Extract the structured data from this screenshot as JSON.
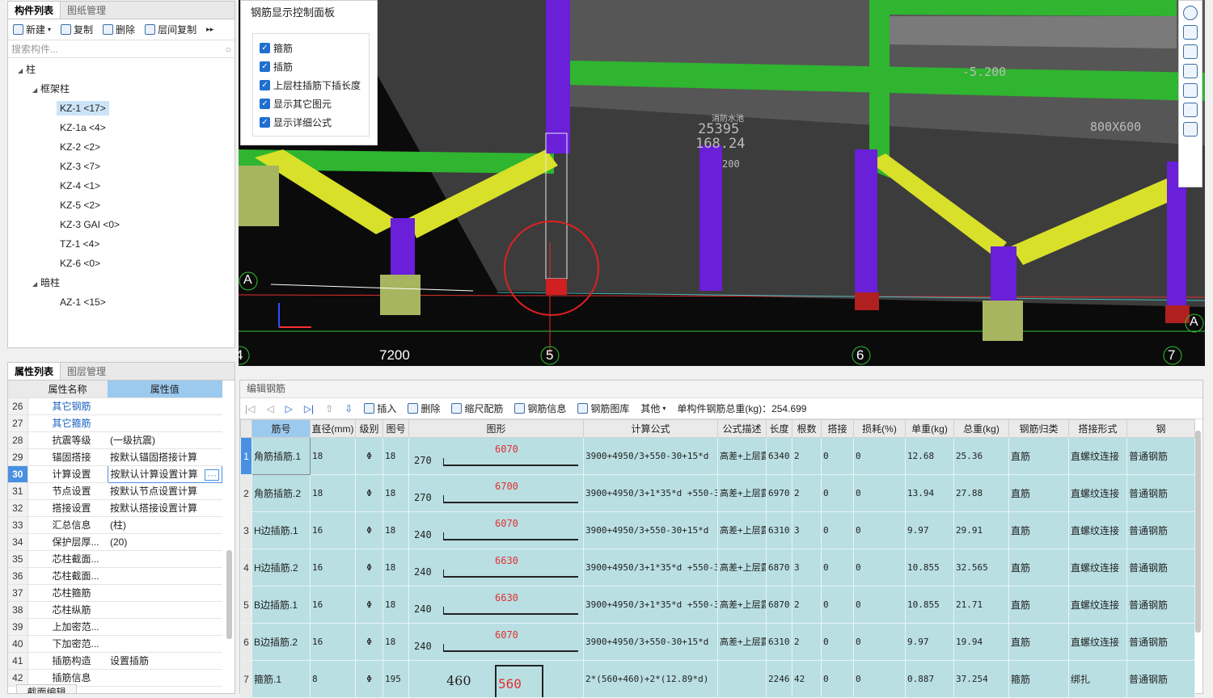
{
  "left_panel": {
    "tabs": [
      "构件列表",
      "图纸管理"
    ],
    "toolbar": {
      "new": "新建",
      "copy": "复制",
      "delete": "删除",
      "floor_copy": "层间复制"
    },
    "search_placeholder": "搜索构件...",
    "tree": {
      "root": "柱",
      "group1": "框架柱",
      "items1": [
        "KZ-1 <17>",
        "KZ-1a <4>",
        "KZ-2 <2>",
        "KZ-3 <7>",
        "KZ-4 <1>",
        "KZ-5 <2>",
        "KZ-3  GAI <0>",
        "TZ-1 <4>",
        "KZ-6 <0>"
      ],
      "group2": "暗柱",
      "items2": [
        "AZ-1 <15>"
      ]
    }
  },
  "prop_panel": {
    "tabs": [
      "属性列表",
      "图层管理"
    ],
    "header": {
      "name": "属性名称",
      "value": "属性值"
    },
    "rows": [
      {
        "no": "26",
        "name": "其它钢筋",
        "value": ""
      },
      {
        "no": "27",
        "name": "其它箍筋",
        "value": ""
      },
      {
        "no": "28",
        "name": "抗震等级",
        "value": "(一级抗震)"
      },
      {
        "no": "29",
        "name": "锚固搭接",
        "value": "按默认锚固搭接计算"
      },
      {
        "no": "30",
        "name": "计算设置",
        "value": "按默认计算设置计算"
      },
      {
        "no": "31",
        "name": "节点设置",
        "value": "按默认节点设置计算"
      },
      {
        "no": "32",
        "name": "搭接设置",
        "value": "按默认搭接设置计算"
      },
      {
        "no": "33",
        "name": "汇总信息",
        "value": "(柱)"
      },
      {
        "no": "34",
        "name": "保护层厚...",
        "value": "(20)"
      },
      {
        "no": "35",
        "name": "芯柱截面...",
        "value": ""
      },
      {
        "no": "36",
        "name": "芯柱截面...",
        "value": ""
      },
      {
        "no": "37",
        "name": "芯柱箍筋",
        "value": ""
      },
      {
        "no": "38",
        "name": "芯柱纵筋",
        "value": ""
      },
      {
        "no": "39",
        "name": "上加密范...",
        "value": ""
      },
      {
        "no": "40",
        "name": "下加密范...",
        "value": ""
      },
      {
        "no": "41",
        "name": "插筋构造",
        "value": "设置插筋"
      },
      {
        "no": "42",
        "name": "插筋信息",
        "value": ""
      }
    ],
    "bottom_tab": "截面编辑"
  },
  "control_panel": {
    "title": "钢筋显示控制面板",
    "options": [
      "箍筋",
      "插筋",
      "上层柱插筋下插长度",
      "显示其它图元",
      "显示详细公式"
    ]
  },
  "viewport": {
    "axis_labels": [
      "4",
      "5",
      "6",
      "7"
    ],
    "row_labels": [
      "A",
      "A"
    ],
    "dimension": "7200",
    "annotations": [
      "-5.200",
      "消防水池",
      "25395",
      "168.24",
      "800X600",
      "200"
    ]
  },
  "bottom_panel": {
    "title": "编辑钢筋",
    "toolbar": {
      "insert": "插入",
      "delete": "删除",
      "scale": "缩尺配筋",
      "info": "钢筋信息",
      "lib": "钢筋图库",
      "other": "其他",
      "total": "单构件钢筋总重(kg)：254.699"
    },
    "columns": [
      "筋号",
      "直径(mm)",
      "级别",
      "图号",
      "图形",
      "计算公式",
      "公式描述",
      "长度",
      "根数",
      "搭接",
      "损耗(%)",
      "单重(kg)",
      "总重(kg)",
      "钢筋归类",
      "搭接形式",
      "钢"
    ],
    "rows": [
      {
        "no": "1",
        "name": "角筋插筋.1",
        "dia": "18",
        "grade": "Φ",
        "fig": "18",
        "sl": "270",
        "sv": "6070",
        "formula": "3900+4950/3+550-30+15*d",
        "desc": "高差+上层露出长...",
        "len": "6340",
        "cnt": "2",
        "lap": "0",
        "loss": "0",
        "unit": "12.68",
        "total": "25.36",
        "cat": "直筋",
        "lapt": "直螺纹连接",
        "type": "普通钢筋"
      },
      {
        "no": "2",
        "name": "角筋插筋.2",
        "dia": "18",
        "grade": "Φ",
        "fig": "18",
        "sl": "270",
        "sv": "6700",
        "formula": "3900+4950/3+1*35*d +550-30+15*d",
        "desc": "高差+上层露出长...",
        "len": "6970",
        "cnt": "2",
        "lap": "0",
        "loss": "0",
        "unit": "13.94",
        "total": "27.88",
        "cat": "直筋",
        "lapt": "直螺纹连接",
        "type": "普通钢筋"
      },
      {
        "no": "3",
        "name": "H边插筋.1",
        "dia": "16",
        "grade": "Φ",
        "fig": "18",
        "sl": "240",
        "sv": "6070",
        "formula": "3900+4950/3+550-30+15*d",
        "desc": "高差+上层露出长...",
        "len": "6310",
        "cnt": "3",
        "lap": "0",
        "loss": "0",
        "unit": "9.97",
        "total": "29.91",
        "cat": "直筋",
        "lapt": "直螺纹连接",
        "type": "普通钢筋"
      },
      {
        "no": "4",
        "name": "H边插筋.2",
        "dia": "16",
        "grade": "Φ",
        "fig": "18",
        "sl": "240",
        "sv": "6630",
        "formula": "3900+4950/3+1*35*d +550-30+15*d",
        "desc": "高差+上层露出长...",
        "len": "6870",
        "cnt": "3",
        "lap": "0",
        "loss": "0",
        "unit": "10.855",
        "total": "32.565",
        "cat": "直筋",
        "lapt": "直螺纹连接",
        "type": "普通钢筋"
      },
      {
        "no": "5",
        "name": "B边插筋.1",
        "dia": "16",
        "grade": "Φ",
        "fig": "18",
        "sl": "240",
        "sv": "6630",
        "formula": "3900+4950/3+1*35*d +550-30+15*d",
        "desc": "高差+上层露出长...",
        "len": "6870",
        "cnt": "2",
        "lap": "0",
        "loss": "0",
        "unit": "10.855",
        "total": "21.71",
        "cat": "直筋",
        "lapt": "直螺纹连接",
        "type": "普通钢筋"
      },
      {
        "no": "6",
        "name": "B边插筋.2",
        "dia": "16",
        "grade": "Φ",
        "fig": "18",
        "sl": "240",
        "sv": "6070",
        "formula": "3900+4950/3+550-30+15*d",
        "desc": "高差+上层露出长...",
        "len": "6310",
        "cnt": "2",
        "lap": "0",
        "loss": "0",
        "unit": "9.97",
        "total": "19.94",
        "cat": "直筋",
        "lapt": "直螺纹连接",
        "type": "普通钢筋"
      },
      {
        "no": "7",
        "name": "箍筋.1",
        "dia": "8",
        "grade": "Φ",
        "fig": "195",
        "sl": "460",
        "sv": "560",
        "formula": "2*(560+460)+2*(12.89*d)",
        "desc": "",
        "len": "2246",
        "cnt": "42",
        "lap": "0",
        "loss": "0",
        "unit": "0.887",
        "total": "37.254",
        "cat": "箍筋",
        "lapt": "绑扎",
        "type": "普通钢筋"
      }
    ]
  },
  "colors": {
    "accent": "#4a90e2",
    "row_bg": "#b9dfe3",
    "beam_green": "#2fb52f",
    "beam_yellow": "#d8e02a",
    "column_purple": "#6a1fd8"
  }
}
